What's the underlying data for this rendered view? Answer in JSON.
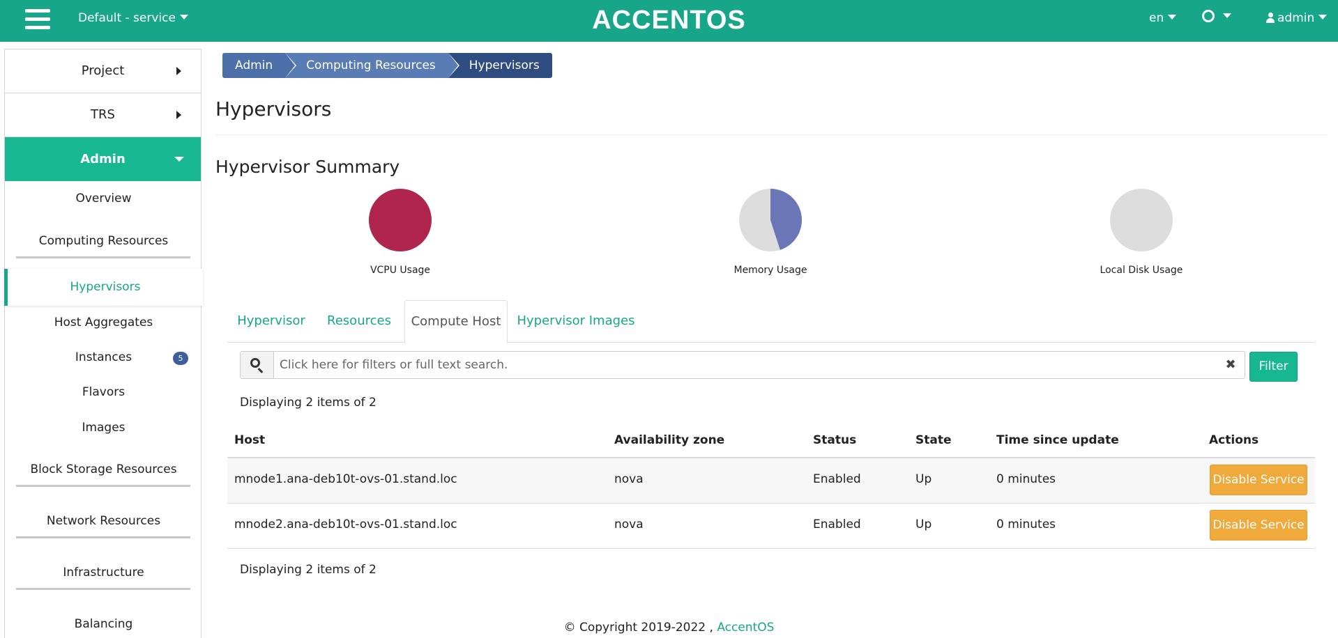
{
  "header": {
    "project_label": "Default - service",
    "logo_text": "ACCENTOS",
    "lang_label": "en",
    "user_label": "admin"
  },
  "sidebar": {
    "project": "Project",
    "trs": "TRS",
    "admin": "Admin",
    "items": {
      "overview": "Overview",
      "computing_resources": "Computing Resources",
      "hypervisors": "Hypervisors",
      "host_aggregates": "Host Aggregates",
      "instances": "Instances",
      "instances_badge": "5",
      "flavors": "Flavors",
      "images": "Images",
      "block_storage": "Block Storage Resources",
      "network_resources": "Network Resources",
      "infrastructure": "Infrastructure",
      "balancing": "Balancing"
    }
  },
  "breadcrumb": [
    "Admin",
    "Computing Resources",
    "Hypervisors"
  ],
  "page_title": "Hypervisors",
  "summary": {
    "title": "Hypervisor Summary",
    "charts": [
      {
        "label": "VCPU Usage",
        "used_fraction": 1.0,
        "color": "#b0254d"
      },
      {
        "label": "Memory Usage",
        "used_fraction": 0.45,
        "color": "#6b76b6"
      },
      {
        "label": "Local Disk Usage",
        "used_fraction": 0.0,
        "color": "#dddddd"
      }
    ]
  },
  "tabs": [
    "Hypervisor",
    "Resources",
    "Compute Host",
    "Hypervisor Images"
  ],
  "active_tab": "Compute Host",
  "search": {
    "placeholder": "Click here for filters or full text search.",
    "filter_label": "Filter"
  },
  "count_text": "Displaying 2 items of 2",
  "table": {
    "columns": [
      "Host",
      "Availability zone",
      "Status",
      "State",
      "Time since update",
      "Actions"
    ],
    "rows": [
      {
        "host": "mnode1.ana-deb10t-ovs-01.stand.loc",
        "zone": "nova",
        "status": "Enabled",
        "state": "Up",
        "time": "0 minutes",
        "action": "Disable Service"
      },
      {
        "host": "mnode2.ana-deb10t-ovs-01.stand.loc",
        "zone": "nova",
        "status": "Enabled",
        "state": "Up",
        "time": "0 minutes",
        "action": "Disable Service"
      }
    ]
  },
  "footer": {
    "text": "© Copyright 2019-2022 , ",
    "link": "AccentOS"
  },
  "colors": {
    "brand": "#17a689",
    "warning": "#f0a93b"
  }
}
